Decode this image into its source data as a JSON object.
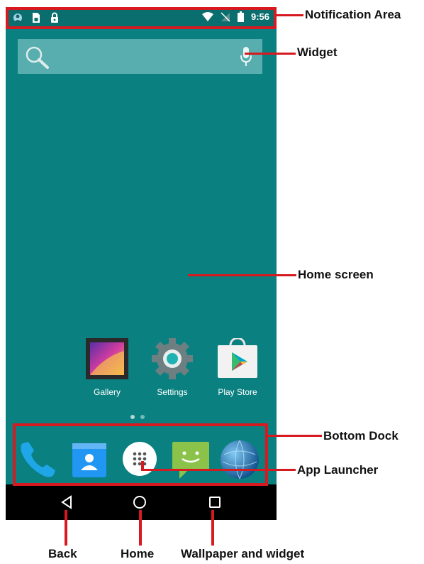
{
  "status_bar": {
    "left_icons": [
      "user-icon",
      "sim-icon",
      "lock-icon"
    ],
    "right_icons": [
      "wifi-icon",
      "no-sim-icon",
      "battery-icon"
    ],
    "time": "9:56"
  },
  "search_widget": {
    "icons": [
      "search-icon",
      "mic-icon"
    ],
    "bar_color": "#5fb2b2"
  },
  "home_apps": [
    {
      "label": "Gallery",
      "icon": "gallery-icon"
    },
    {
      "label": "Settings",
      "icon": "settings-icon"
    },
    {
      "label": "Play Store",
      "icon": "play-store-icon"
    }
  ],
  "page_indicator": {
    "pages": 2,
    "current": 1
  },
  "dock": {
    "apps": [
      "phone-icon",
      "contacts-icon",
      "app-launcher-icon",
      "messaging-icon",
      "browser-icon"
    ]
  },
  "nav_bar": {
    "buttons": [
      "back-icon",
      "home-icon",
      "recents-icon"
    ]
  },
  "annotations": {
    "notification_area": "Notification Area",
    "widget": "Widget",
    "home_screen": "Home screen",
    "bottom_dock": "Bottom Dock",
    "app_launcher": "App Launcher",
    "back": "Back",
    "home": "Home",
    "wallpaper_and_widget": "Wallpaper and widget"
  },
  "colors": {
    "wallpaper": "#0a8080",
    "status_bar": "#0a6e6e",
    "callout_red": "#d71920",
    "nav_bar": "#000000"
  }
}
